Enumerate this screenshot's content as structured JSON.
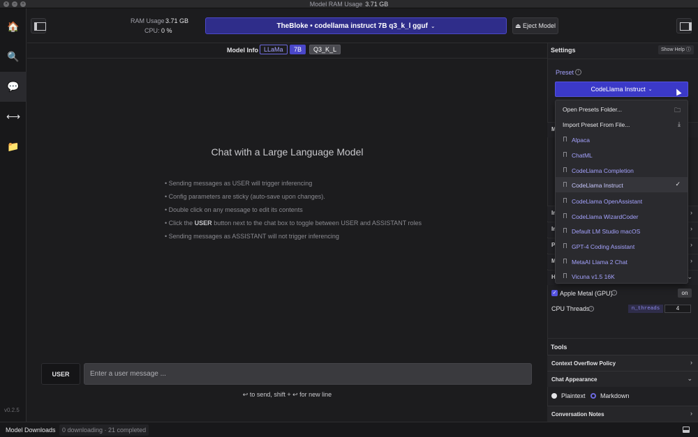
{
  "window": {
    "ram_label": "Model RAM Usage",
    "ram_value": "3.71 GB"
  },
  "rail": {
    "items": [
      {
        "name": "home",
        "icon": "🏠"
      },
      {
        "name": "search",
        "icon": "🔍"
      },
      {
        "name": "chat",
        "icon": "💬"
      },
      {
        "name": "server",
        "icon": "⟷"
      },
      {
        "name": "folder",
        "icon": "📁"
      }
    ],
    "version": "v0.2.5"
  },
  "header": {
    "ram_usage_label": "RAM Usage",
    "ram_usage_value": "3.71 GB",
    "cpu_label": "CPU:",
    "cpu_value": "0 %",
    "model_name": "TheBloke • codellama instruct 7B q3_k_l gguf",
    "eject_label": "⏏ Eject Model"
  },
  "model_info": {
    "label": "Model Info",
    "tags": [
      "LLaMa",
      "7B",
      "Q3_K_L"
    ]
  },
  "chat": {
    "title": "Chat with a Large Language Model",
    "tips": [
      "• Sending messages as USER will trigger inferencing",
      "• Config parameters are sticky (auto-save upon changes).",
      "• Double click on any message to edit its contents",
      "• Sending messages as ASSISTANT will not trigger inferencing"
    ],
    "tip_toggle": {
      "pre": "• Click the ",
      "bold": "USER",
      "post": " button next to the chat box to toggle between USER and ASSISTANT roles"
    },
    "role_button": "USER",
    "input_placeholder": "Enter a user message ...",
    "send_hint": "↩ to send, shift + ↩ for new line"
  },
  "downloads": {
    "label": "Model Downloads",
    "status": "0 downloading · 21 completed"
  },
  "settings": {
    "title": "Settings",
    "show_help": "Show Help ⓘ",
    "preset_label": "Preset",
    "preset_selected": "CodeLlama Instruct",
    "dropdown": {
      "actions": [
        "Open Presets Folder...",
        "Import Preset From File..."
      ],
      "presets": [
        "Alpaca",
        "ChatML",
        "CodeLlama Completion",
        "CodeLlama Instruct",
        "CodeLlama OpenAssistant",
        "CodeLlama WizardCoder",
        "Default LM Studio macOS",
        "GPT-4 Coding Assistant",
        "MetaAI Llama 2 Chat",
        "Vicuna v1.5 16K"
      ]
    },
    "behind_letters": [
      "M",
      "In",
      "In",
      "P",
      "M",
      "H"
    ],
    "apple_metal_label": "Apple Metal (GPU)",
    "apple_metal_state": "on",
    "cpu_threads_label": "CPU Threads",
    "cpu_threads_key": "n_threads",
    "cpu_threads_value": "4",
    "tools_title": "Tools",
    "context_overflow": "Context Overflow Policy",
    "chat_appearance": "Chat Appearance",
    "plaintext": "Plaintext",
    "markdown": "Markdown",
    "conversation_notes": "Conversation Notes"
  }
}
